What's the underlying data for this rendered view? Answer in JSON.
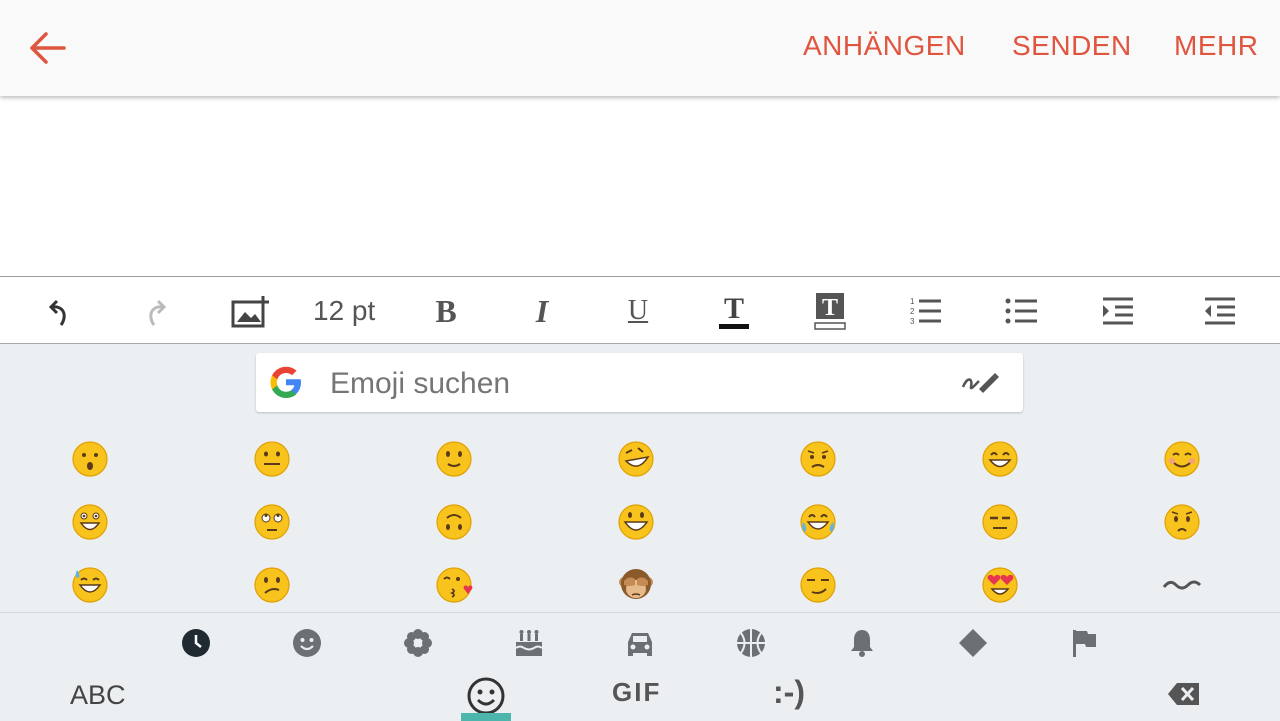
{
  "appbar": {
    "actions": {
      "attach": "ANHÄNGEN",
      "send": "SENDEN",
      "more": "MEHR"
    },
    "accent": "#e0553f"
  },
  "toolbar": {
    "font_size": "12 pt",
    "icons": [
      "undo-icon",
      "redo-icon",
      "insert-image-icon",
      "bold-icon",
      "italic-icon",
      "underline-icon",
      "text-color-icon",
      "highlight-color-icon",
      "numbered-list-icon",
      "bulleted-list-icon",
      "indent-icon",
      "outdent-icon"
    ]
  },
  "keyboard": {
    "search_placeholder": "Emoji suchen",
    "categories": [
      "recent",
      "smileys",
      "nature",
      "food",
      "travel",
      "activities",
      "objects",
      "symbols",
      "flags"
    ],
    "bottom": {
      "abc": "ABC",
      "gif": "GIF",
      "emoticon": ":-)"
    },
    "indicator_color": "#4db6ac"
  }
}
